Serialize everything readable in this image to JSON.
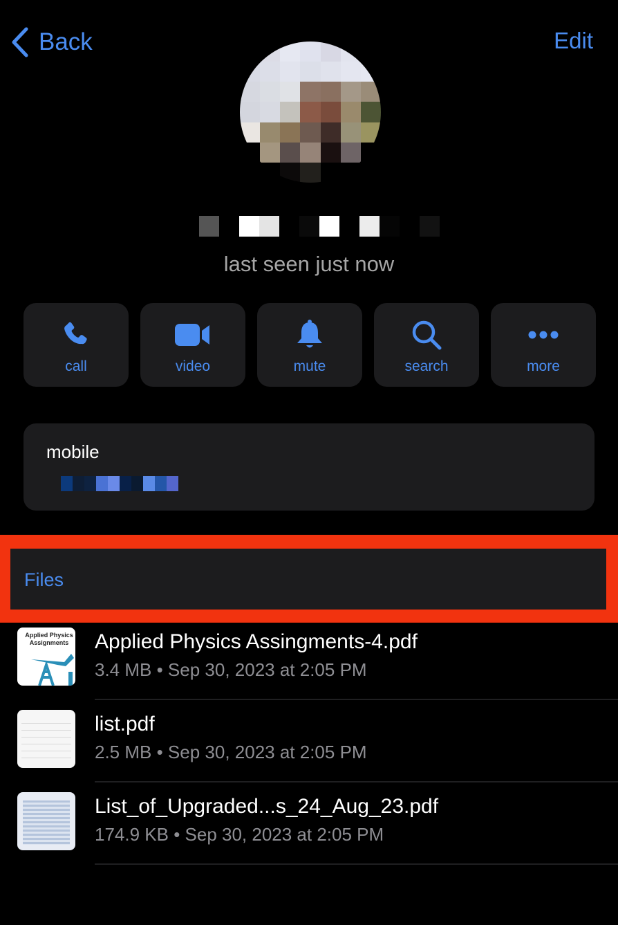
{
  "nav": {
    "back_label": "Back",
    "edit_label": "Edit"
  },
  "profile": {
    "name": "[redacted]",
    "status": "last seen just now"
  },
  "actions": [
    {
      "label": "call",
      "icon": "phone-icon"
    },
    {
      "label": "video",
      "icon": "video-camera-icon"
    },
    {
      "label": "mute",
      "icon": "bell-icon"
    },
    {
      "label": "search",
      "icon": "magnifier-icon"
    },
    {
      "label": "more",
      "icon": "ellipsis-icon"
    }
  ],
  "contact_info": {
    "label": "mobile",
    "value": "[redacted]"
  },
  "files_section": {
    "title": "Files",
    "highlight_color": "#f2330f",
    "items": [
      {
        "name": "Applied Physics Assingments-4.pdf",
        "meta": "3.4 MB • Sep 30, 2023 at 2:05 PM",
        "thumb_text": "Applied Physics Assignments"
      },
      {
        "name": "list.pdf",
        "meta": "2.5 MB • Sep 30, 2023 at 2:05 PM"
      },
      {
        "name": "List_of_Upgraded...s_24_Aug_23.pdf",
        "meta": "174.9 KB • Sep 30, 2023 at 2:05 PM"
      }
    ]
  },
  "colors": {
    "accent": "#4a8cf0",
    "card_bg": "#1c1c1e",
    "secondary_text": "#8e8e93"
  }
}
